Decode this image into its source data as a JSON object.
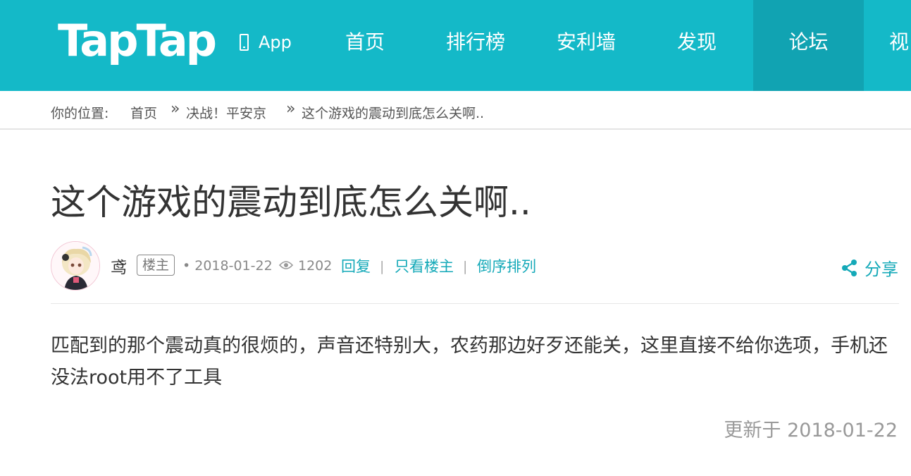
{
  "header": {
    "logo": "TapTap",
    "app_label": "App",
    "nav": [
      "首页",
      "排行榜",
      "安利墙",
      "发现",
      "论坛",
      "视"
    ],
    "active_nav": "论坛"
  },
  "breadcrumb": {
    "prefix": "你的位置:",
    "items": [
      "首页",
      "决战！平安京",
      "这个游戏的震动到底怎么关啊.."
    ],
    "separator": "»"
  },
  "post": {
    "title": "这个游戏的震动到底怎么关啊..",
    "author": "鸢",
    "author_badge": "楼主",
    "date": "• 2018-01-22",
    "views": "1202",
    "actions": [
      "回复",
      "只看楼主",
      "倒序排列"
    ],
    "action_separator": "|",
    "share_label": "分享",
    "body": "匹配到的那个震动真的很烦的，声音还特别大，农药那边好歹还能关，这里直接不给你选项，手机还没法root用不了工具",
    "updated": "更新于 2018-01-22"
  },
  "colors": {
    "header_bg": "#14b9c8",
    "active_nav_bg": "#11a3b2",
    "link": "#14a9b8"
  }
}
